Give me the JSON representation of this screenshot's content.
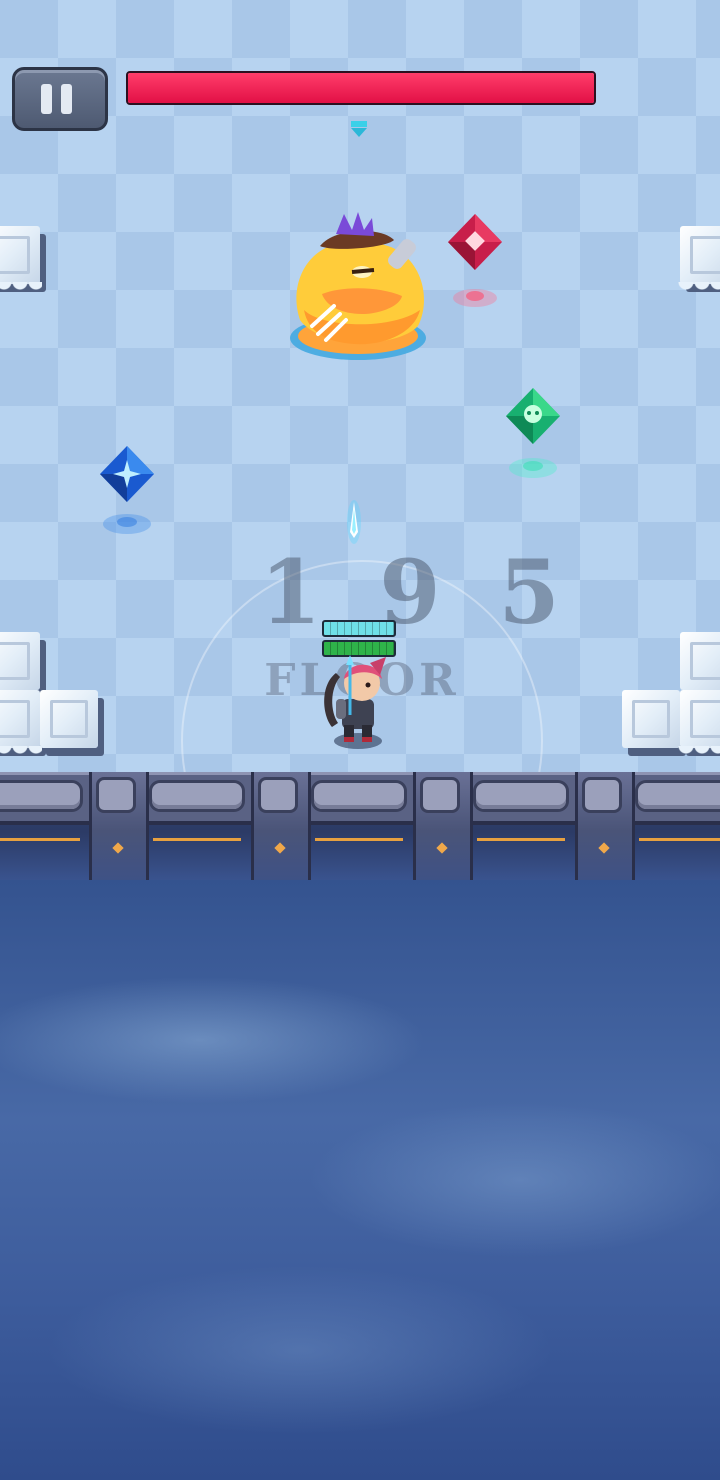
{
  "hud": {
    "pause_icon": "pause-icon",
    "boss_health_fraction": 1.0,
    "boss_health_color": "#e8194c"
  },
  "floor": {
    "number": "195",
    "label": "FLOOR"
  },
  "player": {
    "shield_fraction": 1.0,
    "health_fraction": 1.0
  },
  "entities": {
    "boss": "pudding-boss",
    "player": "archer-hero",
    "gems": [
      "red-shuriken-gem",
      "green-skull-gem",
      "blue-star-gem"
    ]
  },
  "colors": {
    "arena_light": "#b7d3f0",
    "arena_dark": "#a9c7e8",
    "wall": "#5a6284",
    "sky": "#3a5a96"
  }
}
